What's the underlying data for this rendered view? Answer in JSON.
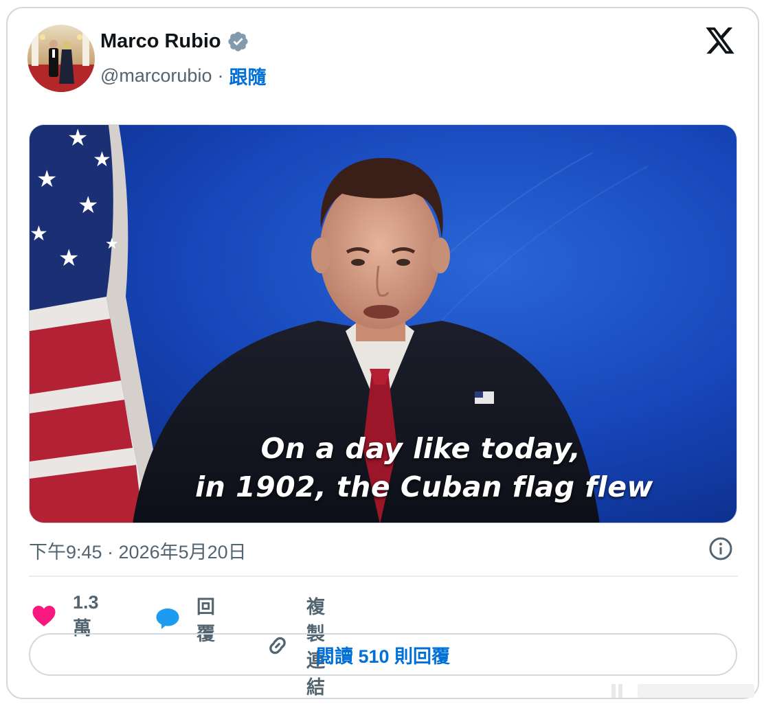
{
  "author": {
    "name": "Marco Rubio",
    "handle": "@marcorubio",
    "separator": "·",
    "follow_label": "跟隨",
    "verified_icon": "verified-badge-icon",
    "avatar_icon": "profile-photo"
  },
  "platform": {
    "logo_icon": "x-logo-icon"
  },
  "media": {
    "type": "video",
    "caption_line1": "On a day like today,",
    "caption_line2": "in 1902, the Cuban flag flew"
  },
  "timestamp": "下午9:45 · 2026年5月20日",
  "info_icon": "info-icon",
  "actions": {
    "like": {
      "icon": "heart-icon",
      "label": "1.3萬",
      "color": "#f91880"
    },
    "reply": {
      "icon": "speech-bubble-icon",
      "label": "回覆",
      "color": "#1d9bf0"
    },
    "copy_link": {
      "icon": "link-icon",
      "label": "複製連結"
    }
  },
  "read_replies_label": "閱讀 510 則回覆",
  "colors": {
    "text_primary": "#0f1419",
    "text_secondary": "#536471",
    "link_blue": "#006fd6",
    "border": "#cfd9de"
  }
}
